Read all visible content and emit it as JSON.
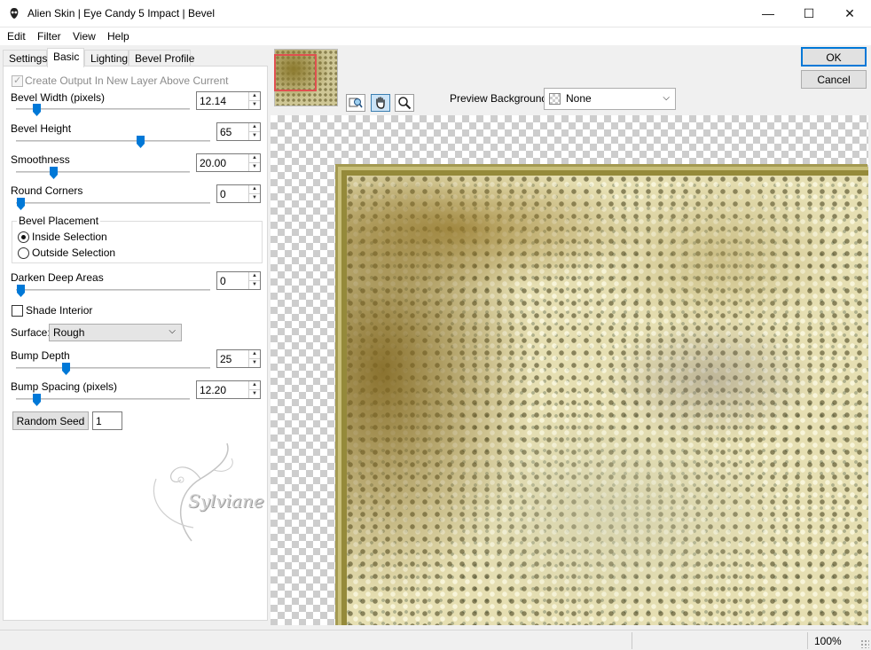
{
  "window": {
    "title": "Alien Skin | Eye Candy 5 Impact | Bevel",
    "minimize_glyph": "—",
    "maximize_glyph": "☐",
    "close_glyph": "✕"
  },
  "menu": {
    "items": [
      "Edit",
      "Filter",
      "View",
      "Help"
    ]
  },
  "tabs": [
    "Settings",
    "Basic",
    "Lighting",
    "Bevel Profile"
  ],
  "active_tab": "Basic",
  "basic": {
    "create_output_label": "Create Output In New Layer Above Current",
    "create_output_checked": true,
    "bevel_width": {
      "label": "Bevel Width (pixels)",
      "value": "12.14",
      "slider_fraction": 0.11
    },
    "bevel_height": {
      "label": "Bevel Height",
      "value": "65",
      "slider_fraction": 0.65
    },
    "smoothness": {
      "label": "Smoothness",
      "value": "20.00",
      "slider_fraction": 0.2
    },
    "round_corners": {
      "label": "Round Corners",
      "value": "0",
      "slider_fraction": 0.0
    },
    "bevel_placement": {
      "label": "Bevel Placement",
      "options": [
        "Inside Selection",
        "Outside Selection"
      ],
      "selected": "Inside Selection"
    },
    "darken_deep_areas": {
      "label": "Darken Deep Areas",
      "value": "0",
      "slider_fraction": 0.0
    },
    "shade_interior": {
      "label": "Shade Interior",
      "checked": false
    },
    "surface": {
      "label": "Surface:",
      "value": "Rough"
    },
    "bump_depth": {
      "label": "Bump Depth",
      "value": "25",
      "slider_fraction": 0.25
    },
    "bump_spacing": {
      "label": "Bump Spacing (pixels)",
      "value": "12.20",
      "slider_fraction": 0.12
    },
    "random_seed": {
      "button_label": "Random Seed",
      "value": "1"
    }
  },
  "watermark_text": "Sylviane",
  "actions": {
    "ok_label": "OK",
    "cancel_label": "Cancel"
  },
  "preview": {
    "background_label": "Preview Background:",
    "background_value": "None",
    "tools": [
      "zoom-fit-icon",
      "hand-pan-icon",
      "magnifier-icon"
    ],
    "active_tool": "hand-pan-icon"
  },
  "status": {
    "zoom": "100%"
  },
  "colors": {
    "accent": "#0078d7",
    "thumbnail_selection": "#e05050",
    "frame": "#958a3a"
  }
}
